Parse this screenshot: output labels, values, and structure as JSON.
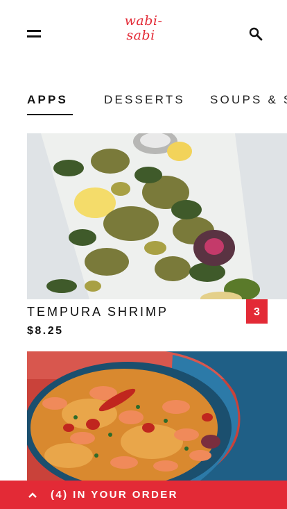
{
  "header": {
    "menu_icon": "hamburger-menu-icon",
    "logo_line1": "wabi-",
    "logo_line2": "sabi",
    "search_icon": "search-icon",
    "brand_color": "#e32a36"
  },
  "tabs": [
    {
      "label": "APPS",
      "active": true
    },
    {
      "label": "DESSERTS",
      "active": false
    },
    {
      "label": "SOUPS & S",
      "active": false
    }
  ],
  "items": [
    {
      "name": "TEMPURA SHRIMP",
      "price": "$8.25",
      "quantity": "3"
    }
  ],
  "order_bar": {
    "chevron_icon": "chevron-up-icon",
    "label": "(4) IN YOUR ORDER"
  }
}
